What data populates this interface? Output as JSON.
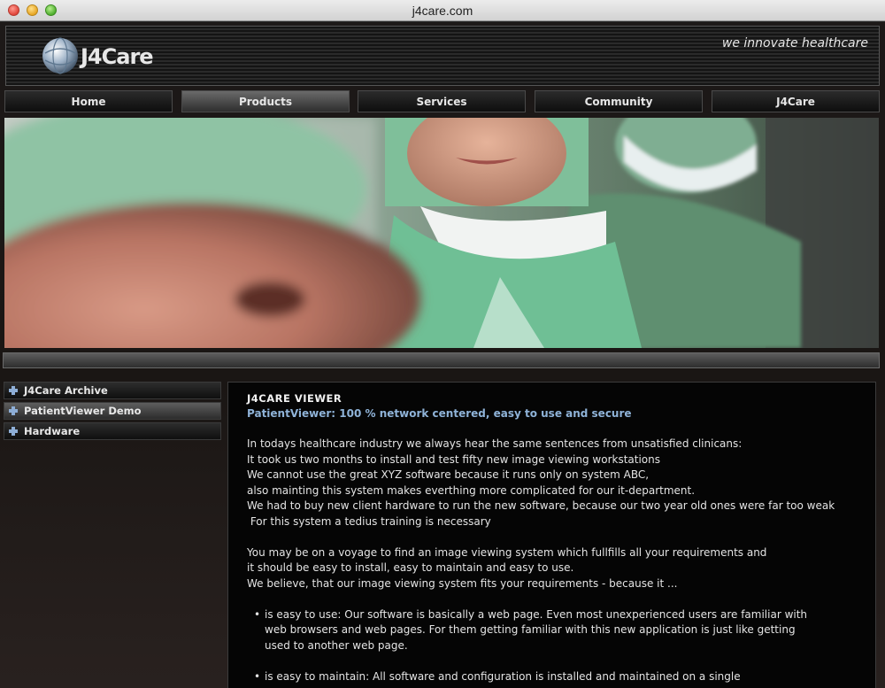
{
  "window": {
    "title": "j4care.com"
  },
  "header": {
    "logo_text": "J4Care",
    "tagline": "we innovate healthcare"
  },
  "nav": {
    "items": [
      "Home",
      "Products",
      "Services",
      "Community",
      "J4Care"
    ],
    "active": "Products"
  },
  "sidebar": {
    "items": [
      "J4Care Archive",
      "PatientViewer Demo",
      "Hardware"
    ],
    "active": "PatientViewer Demo"
  },
  "content": {
    "heading": "J4CARE VIEWER",
    "subtitle": "PatientViewer: 100 % network centered, easy to use and secure",
    "para1": [
      "In todays healthcare industry we always hear the same sentences from unsatisfied clinicans:",
      "It took us two months to install and test fifty new image viewing workstations",
      "We cannot use the great XYZ software because it runs only on system ABC,",
      "also mainting this system makes everthing more complicated for our it-department.",
      "We had to buy new client hardware to run the new software, because our two year old ones were far too weak",
      " For this system a tedius training is necessary"
    ],
    "para2": [
      "You may be on a voyage to find an image viewing system which fullfills all your requirements and",
      "it should be easy to install, easy to maintain and easy to use.",
      "We believe, that our image viewing system fits your requirements - because it ..."
    ],
    "bullet_symbol": "•",
    "bullet1": [
      "is easy to use: Our software is basically a web page. Even most unexperienced users are familiar with",
      "web browsers and web pages. For them getting familiar with this new application is just like getting",
      "used to another web page."
    ],
    "bullet2": [
      "is easy to maintain: All software and configuration is installed and maintained on a single"
    ]
  },
  "colors": {
    "accent_blue": "#8fb3d8",
    "page_bg": "#1a1614",
    "content_bg": "#050505"
  }
}
